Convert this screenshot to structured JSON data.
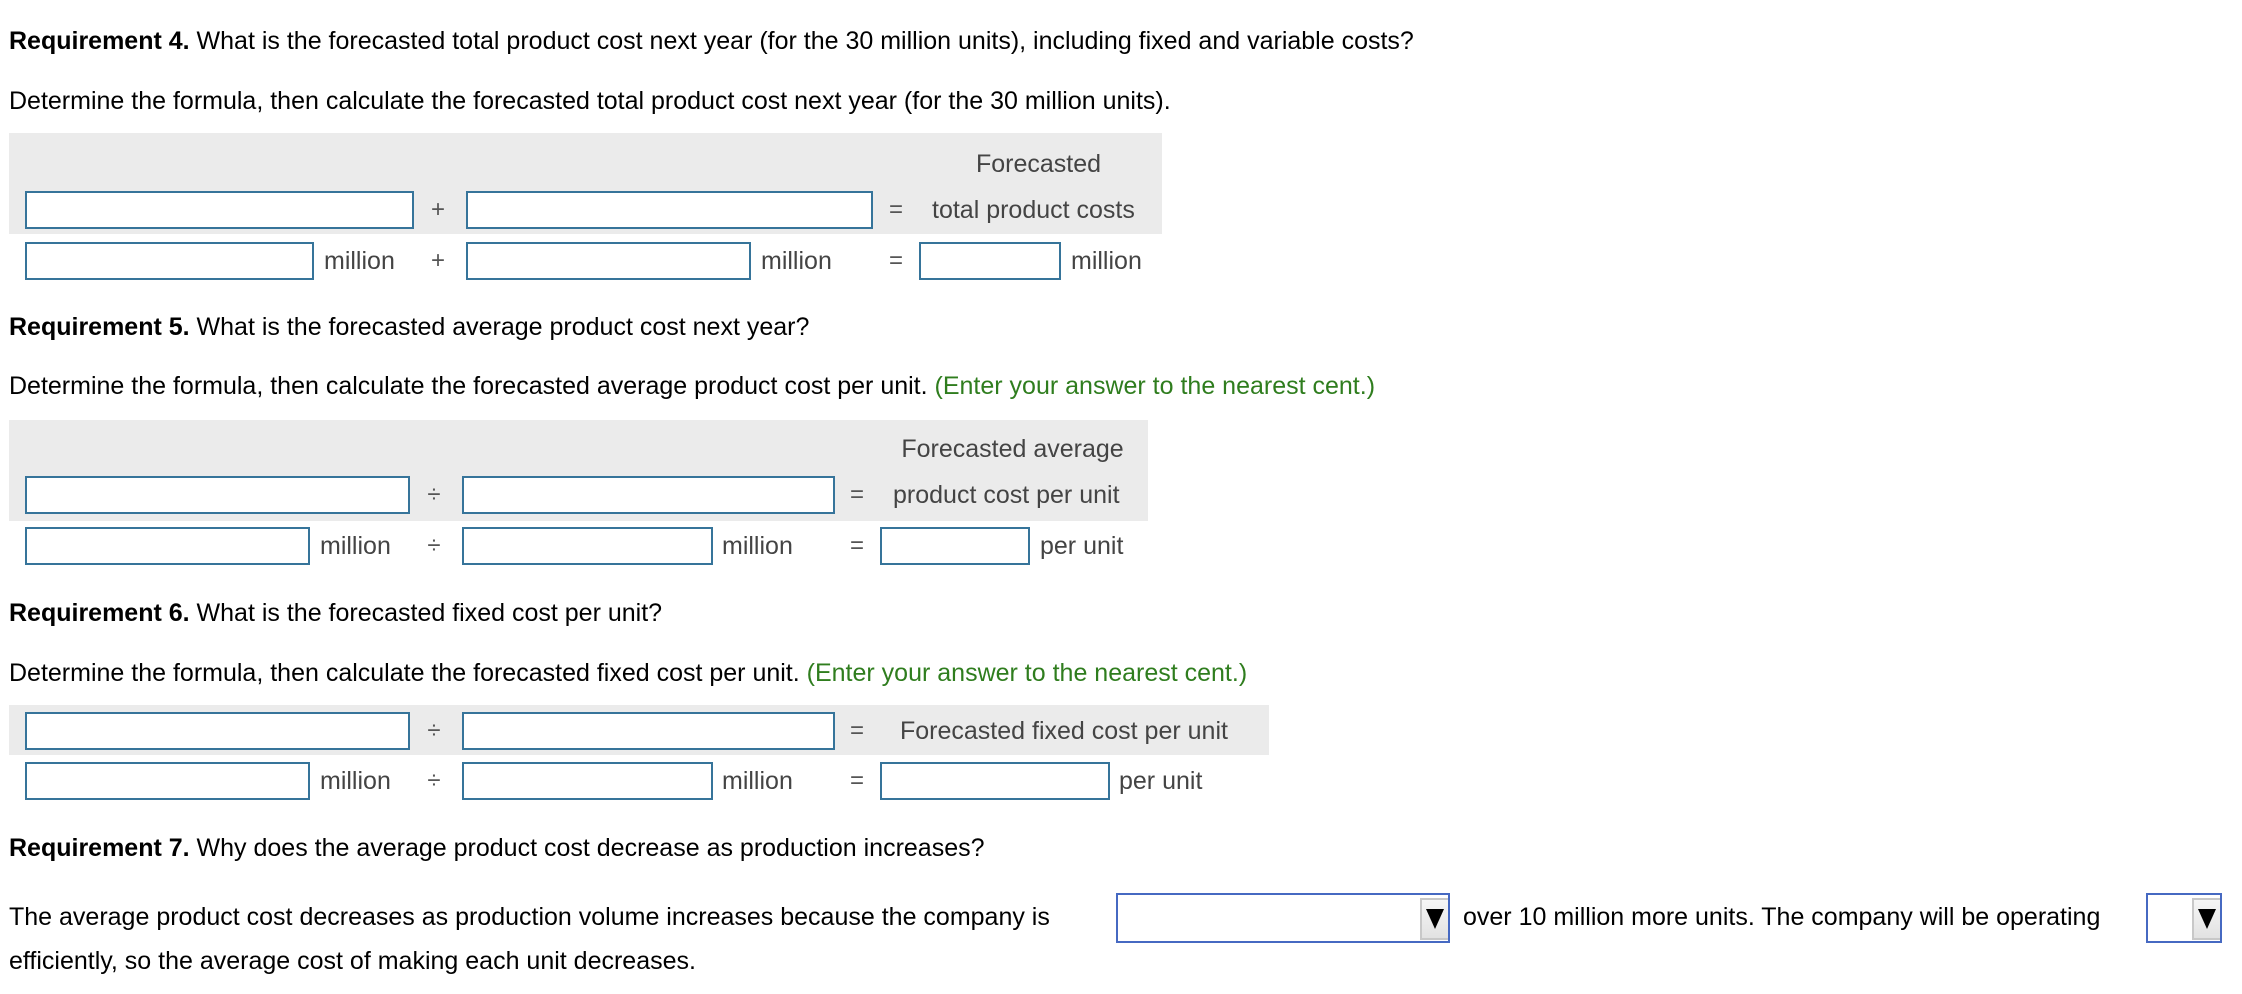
{
  "req4": {
    "heading_bold": "Requirement 4.",
    "heading_text": " What is the forecasted total product cost next year (for the 30 million units), including fixed and variable costs?",
    "instruction": "Determine the formula, then calculate the forecasted total product cost next year (for the 30 million units).",
    "result_header_line1": "Forecasted",
    "result_header_line2": "total product costs",
    "operator": "+",
    "equals": "=",
    "unit_label": "million",
    "formula_inputs": [
      "",
      ""
    ],
    "value_inputs": [
      "",
      ""
    ],
    "result_value": "",
    "result_unit": "million"
  },
  "req5": {
    "heading_bold": "Requirement 5.",
    "heading_text": " What is the forecasted average product cost next year?",
    "instruction": "Determine the formula, then calculate the forecasted average product cost per unit.",
    "hint": "(Enter your answer to the nearest cent.)",
    "result_header_line1": "Forecasted average",
    "result_header_line2": "product cost per unit",
    "operator": "÷",
    "equals": "=",
    "unit_label": "million",
    "formula_inputs": [
      "",
      ""
    ],
    "value_inputs": [
      "",
      ""
    ],
    "result_value": "",
    "result_unit": "per unit"
  },
  "req6": {
    "heading_bold": "Requirement 6.",
    "heading_text": " What is the forecasted fixed cost per unit?",
    "instruction": "Determine the formula, then calculate the forecasted fixed cost per unit.",
    "hint": "(Enter your answer to the nearest cent.)",
    "result_header": "Forecasted fixed cost per unit",
    "operator": "÷",
    "equals": "=",
    "unit_label": "million",
    "formula_inputs": [
      "",
      ""
    ],
    "value_inputs": [
      "",
      ""
    ],
    "result_value": "",
    "result_unit": "per unit"
  },
  "req7": {
    "heading_bold": "Requirement 7.",
    "heading_text": " Why does the average product cost decrease as production increases?",
    "sentence_part1": "The average product cost decreases as production volume increases because the company is",
    "dropdown1_value": "",
    "sentence_part2": "over 10 million more units. The company will be operating",
    "dropdown2_value": "",
    "sentence_part3": "efficiently, so the average cost of making each unit decreases."
  },
  "colors": {
    "input_border": "#36749a",
    "dropdown_border": "#4669c2",
    "hint_green": "#2f7d1e",
    "panel_gray": "#ebebeb"
  }
}
